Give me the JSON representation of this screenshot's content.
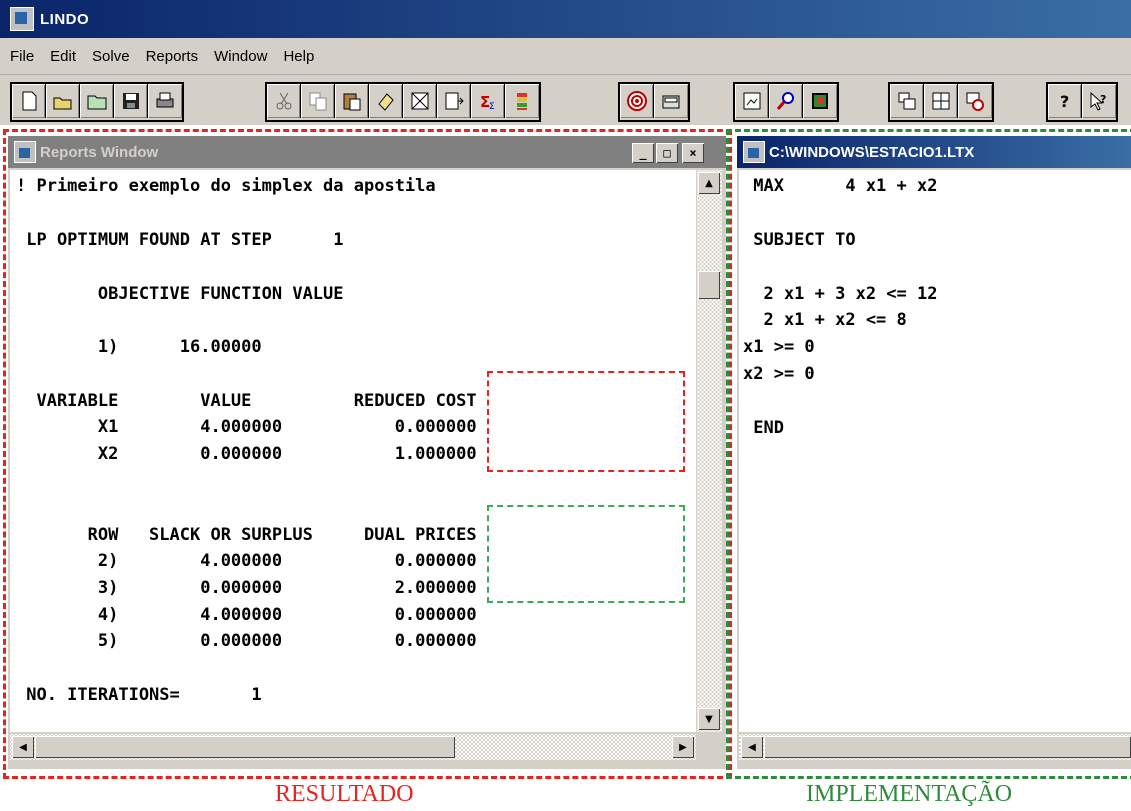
{
  "app": {
    "title": "LINDO"
  },
  "menu": [
    "File",
    "Edit",
    "Solve",
    "Reports",
    "Window",
    "Help"
  ],
  "reports_window": {
    "title": "Reports Window",
    "controls": [
      "_",
      "□",
      "×"
    ],
    "lines": [
      "! Primeiro exemplo do simplex da apostila",
      "",
      " LP OPTIMUM FOUND AT STEP      1",
      "",
      "        OBJECTIVE FUNCTION VALUE",
      "",
      "        1)      16.00000",
      "",
      "  VARIABLE        VALUE          REDUCED COST",
      "        X1        4.000000           0.000000",
      "        X2        0.000000           1.000000",
      "",
      "",
      "       ROW   SLACK OR SURPLUS     DUAL PRICES",
      "        2)        4.000000           0.000000",
      "        3)        0.000000           2.000000",
      "        4)        4.000000           0.000000",
      "        5)        0.000000           0.000000",
      "",
      " NO. ITERATIONS=       1"
    ]
  },
  "model_window": {
    "title": "C:\\WINDOWS\\ESTACIO1.LTX",
    "lines": [
      " MAX      4 x1 + x2",
      "",
      " SUBJECT TO",
      "",
      "  2 x1 + 3 x2 <= 12",
      "  2 x1 + x2 <= 8",
      "x1 >= 0",
      "x2 >= 0",
      "",
      " END"
    ]
  },
  "captions": {
    "left": "RESULTADO",
    "right": "IMPLEMENTAÇÃO"
  },
  "colors": {
    "red": "#e52420",
    "green": "#2e8b3c",
    "title_bar": "#0a246a"
  }
}
